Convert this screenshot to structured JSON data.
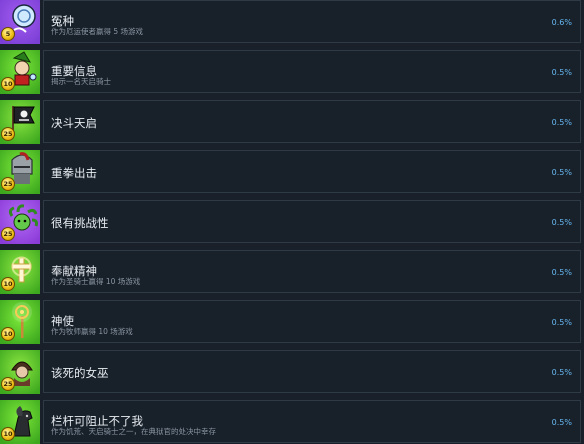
{
  "achievements": [
    {
      "title": "冤种",
      "desc": "作为厄运使者赢得 5 场游戏",
      "percent": "0.6%",
      "points": "5",
      "icon": "ghost-spirit-icon",
      "bg": [
        "#7b3fd6",
        "#a35cf0"
      ]
    },
    {
      "title": "重要信息",
      "desc": "揭示一名天启骑士",
      "percent": "0.5%",
      "points": "10",
      "icon": "wizard-doctor-icon",
      "bg": [
        "#3da81e",
        "#7ce83a"
      ]
    },
    {
      "title": "决斗天启",
      "desc": "",
      "percent": "0.5%",
      "points": "25",
      "icon": "pirate-flag-icon",
      "bg": [
        "#3da81e",
        "#8ce642"
      ]
    },
    {
      "title": "重拳出击",
      "desc": "",
      "percent": "0.5%",
      "points": "25",
      "icon": "knight-helmet-icon",
      "bg": [
        "#3da81e",
        "#7ce83a"
      ]
    },
    {
      "title": "很有挑战性",
      "desc": "",
      "percent": "0.5%",
      "points": "25",
      "icon": "medusa-icon",
      "bg": [
        "#8b3bd8",
        "#b46cf5"
      ]
    },
    {
      "title": "奉献精神",
      "desc": "作为圣骑士赢得 10 场游戏",
      "percent": "0.5%",
      "points": "10",
      "icon": "holy-cross-icon",
      "bg": [
        "#3da81e",
        "#8ce642"
      ]
    },
    {
      "title": "神使",
      "desc": "作为牧师赢得 10 场游戏",
      "percent": "0.5%",
      "points": "10",
      "icon": "cleric-staff-icon",
      "bg": [
        "#3da81e",
        "#7ce83a"
      ]
    },
    {
      "title": "该死的女巫",
      "desc": "",
      "percent": "0.5%",
      "points": "25",
      "icon": "witch-icon",
      "bg": [
        "#3da81e",
        "#8ce642"
      ]
    },
    {
      "title": "栏杆可阻止不了我",
      "desc": "作为饥荒、天启骑士之一，在典狱官的处决中幸存",
      "percent": "0.5%",
      "points": "10",
      "icon": "famine-horseman-icon",
      "bg": [
        "#3da81e",
        "#7ce83a"
      ]
    }
  ]
}
